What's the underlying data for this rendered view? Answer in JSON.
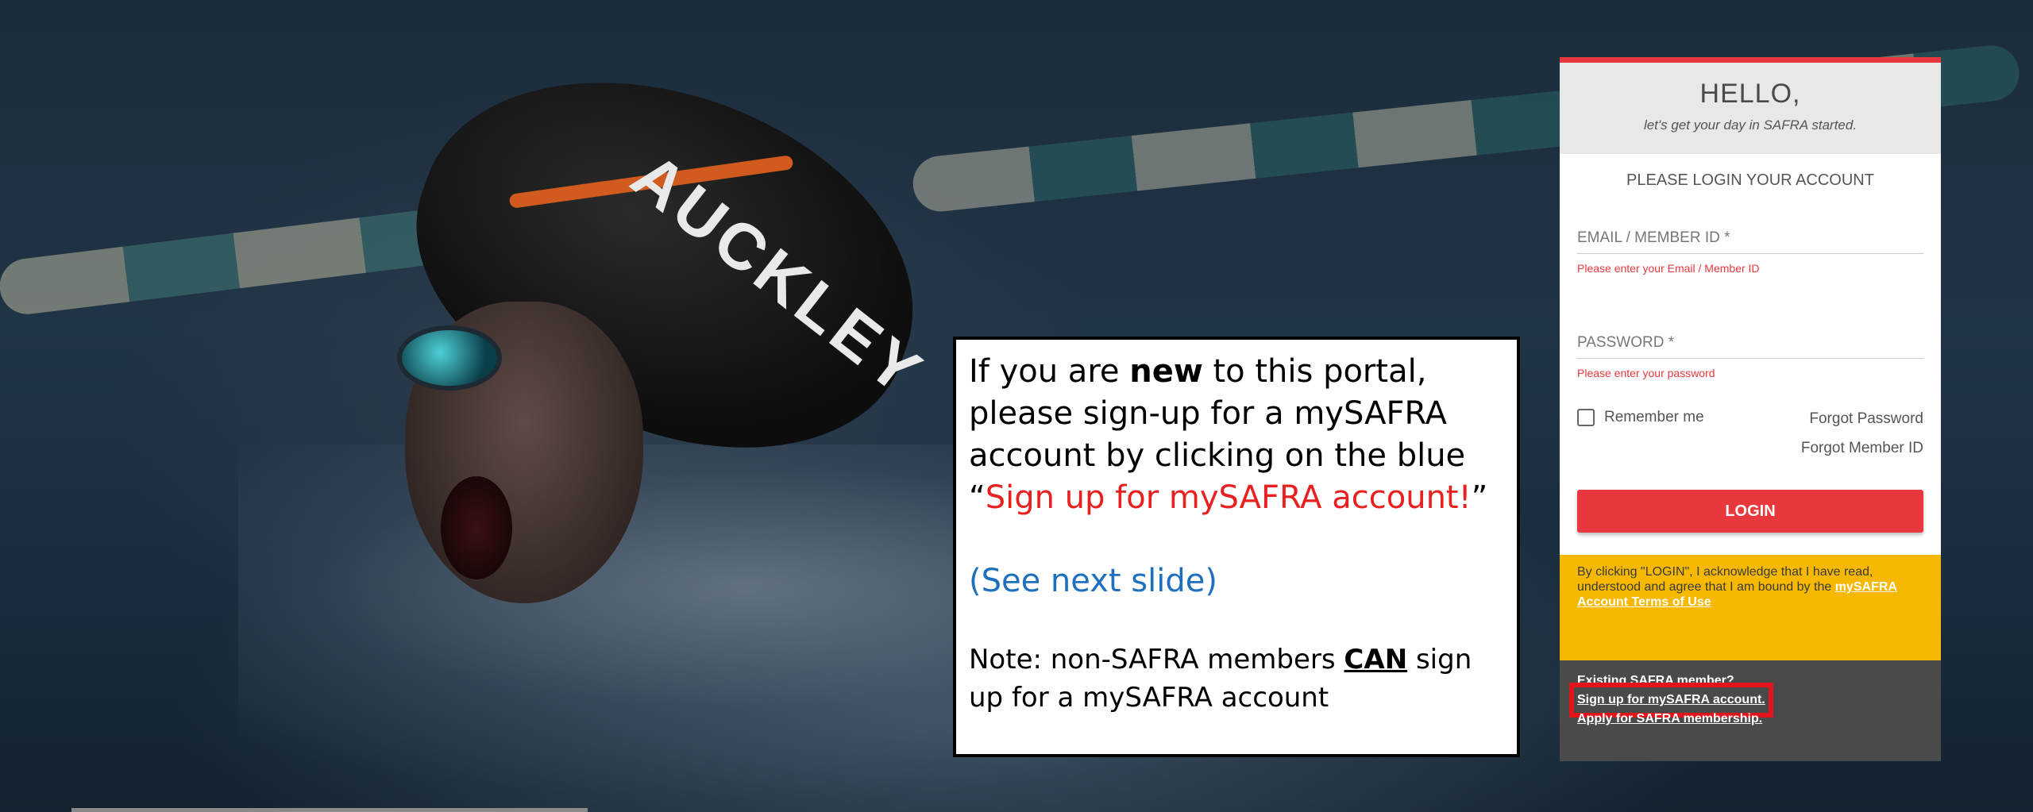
{
  "background": {
    "cap_text": "AUCKLEY"
  },
  "callout": {
    "line1_prefix": "If you are ",
    "line1_bold": "new",
    "line1_suffix": " to this portal, please sign-up for a mySAFRA account by clicking on the blue “",
    "red_text": "Sign up for mySAFRA account!",
    "line1_end": "”",
    "see_next": "(See next slide)",
    "note_prefix": "Note: non-SAFRA members ",
    "note_can": "CAN",
    "note_suffix": " sign up for a mySAFRA account"
  },
  "login": {
    "hello": "HELLO,",
    "tagline": "let's get your day in SAFRA started.",
    "please": "PLEASE LOGIN YOUR ACCOUNT",
    "email_label": "EMAIL / MEMBER ID *",
    "email_error": "Please enter your Email / Member ID",
    "password_label": "PASSWORD *",
    "password_error": "Please enter your password",
    "remember_label": "Remember me",
    "forgot_password": "Forgot Password",
    "forgot_member_id": "Forgot Member ID",
    "login_button": "LOGIN",
    "terms_text": "By clicking \"LOGIN\", I acknowledge that I have read, understood and agree that I am bound by the ",
    "terms_link": "mySAFRA Account Terms of Use",
    "existing": "Existing SAFRA member?",
    "signup_link": "Sign up for mySAFRA account.",
    "apply_link": "Apply for SAFRA membership."
  },
  "colors": {
    "accent_red": "#e8383d",
    "terms_yellow": "#f6b800",
    "bottom_gray": "#4a4a4a",
    "callout_red": "#e8201f",
    "callout_blue": "#1f6fbf"
  }
}
